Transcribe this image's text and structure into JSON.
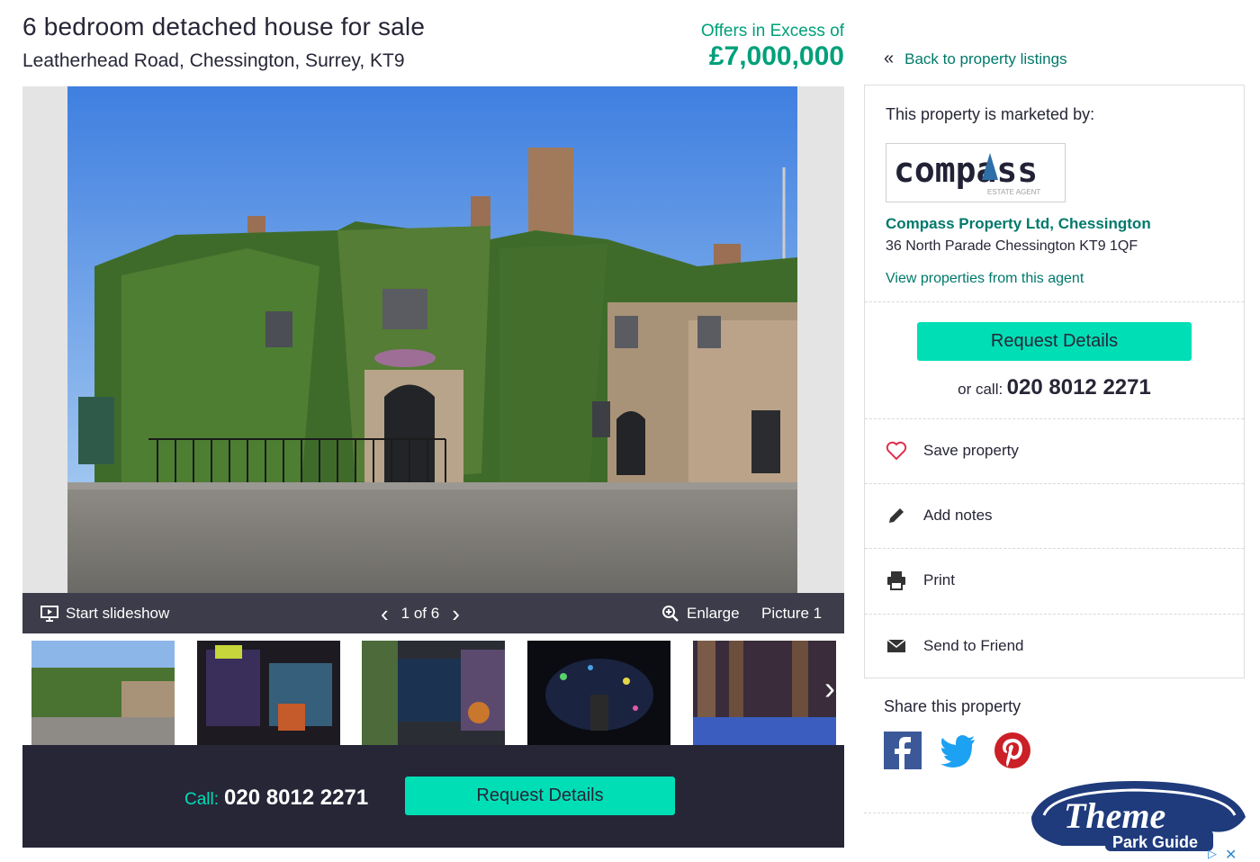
{
  "listing": {
    "title": "6 bedroom detached house for sale",
    "address": "Leatherhead Road, Chessington, Surrey, KT9",
    "price_qualifier": "Offers in Excess of",
    "price": "£7,000,000"
  },
  "gallery": {
    "start_slideshow": "Start slideshow",
    "counter": "1 of 6",
    "enlarge": "Enlarge",
    "picture_label": "Picture 1",
    "thumbnail_count": 5
  },
  "call_strip": {
    "call_label": "Call:",
    "phone": "020 8012 2271",
    "button": "Request Details"
  },
  "sidebar": {
    "back_link": "Back to property listings",
    "marketed_by": "This property is marketed by:",
    "logo_text": "compass",
    "logo_subtext": "ESTATE AGENT",
    "agent_name": "Compass Property Ltd, Chessington",
    "agent_address": "36 North Parade Chessington KT9 1QF",
    "view_properties": "View properties from this agent",
    "request_button": "Request Details",
    "or_call_label": "or call:",
    "phone": "020 8012 2271",
    "actions": [
      {
        "label": "Save property",
        "icon": "heart-icon"
      },
      {
        "label": "Add notes",
        "icon": "pencil-icon"
      },
      {
        "label": "Print",
        "icon": "printer-icon"
      },
      {
        "label": "Send to Friend",
        "icon": "envelope-icon"
      }
    ],
    "share_title": "Share this property",
    "share_icons": [
      "facebook-icon",
      "twitter-icon",
      "pinterest-icon"
    ]
  },
  "watermark": {
    "line1": "Theme",
    "line2": "Park Guide"
  },
  "colors": {
    "accent": "#00deb6",
    "link": "#00796b",
    "price": "#00a07a",
    "dark": "#262637"
  }
}
